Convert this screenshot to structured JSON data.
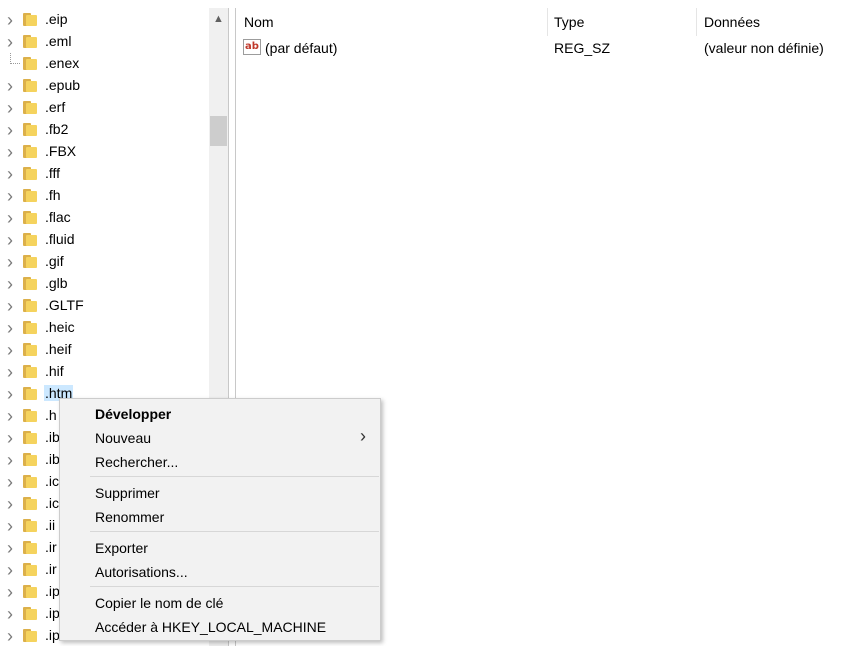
{
  "tree": {
    "items": [
      {
        "label": ".eip",
        "has_children": true
      },
      {
        "label": ".eml",
        "has_children": true
      },
      {
        "label": ".enex",
        "has_children": false
      },
      {
        "label": ".epub",
        "has_children": true
      },
      {
        "label": ".erf",
        "has_children": true
      },
      {
        "label": ".fb2",
        "has_children": true
      },
      {
        "label": ".FBX",
        "has_children": true
      },
      {
        "label": ".fff",
        "has_children": true
      },
      {
        "label": ".fh",
        "has_children": true
      },
      {
        "label": ".flac",
        "has_children": true
      },
      {
        "label": ".fluid",
        "has_children": true
      },
      {
        "label": ".gif",
        "has_children": true
      },
      {
        "label": ".glb",
        "has_children": true
      },
      {
        "label": ".GLTF",
        "has_children": true
      },
      {
        "label": ".heic",
        "has_children": true
      },
      {
        "label": ".heif",
        "has_children": true
      },
      {
        "label": ".hif",
        "has_children": true
      },
      {
        "label": ".htm",
        "has_children": true,
        "selected": true
      },
      {
        "label": ".h",
        "has_children": true
      },
      {
        "label": ".ib",
        "has_children": true
      },
      {
        "label": ".ib",
        "has_children": true
      },
      {
        "label": ".ic",
        "has_children": true
      },
      {
        "label": ".ic",
        "has_children": true
      },
      {
        "label": ".ii",
        "has_children": true
      },
      {
        "label": ".ir",
        "has_children": true
      },
      {
        "label": ".ir",
        "has_children": true
      },
      {
        "label": ".ip",
        "has_children": true
      },
      {
        "label": ".ip",
        "has_children": true
      },
      {
        "label": ".ip",
        "has_children": true
      }
    ]
  },
  "list": {
    "columns": {
      "name": "Nom",
      "type": "Type",
      "data": "Données"
    },
    "rows": [
      {
        "icon": "string-value-icon",
        "icon_text": "ab",
        "name": "(par défaut)",
        "type": "REG_SZ",
        "data": "(valeur non définie)"
      }
    ]
  },
  "context_menu": {
    "items": [
      {
        "label": "Développer",
        "bold": true
      },
      {
        "label": "Nouveau",
        "submenu": true
      },
      {
        "label": "Rechercher..."
      },
      {
        "separator": true
      },
      {
        "label": "Supprimer"
      },
      {
        "label": "Renommer"
      },
      {
        "separator": true
      },
      {
        "label": "Exporter"
      },
      {
        "label": "Autorisations..."
      },
      {
        "separator": true
      },
      {
        "label": "Copier le nom de clé"
      },
      {
        "label": "Accéder à HKEY_LOCAL_MACHINE"
      }
    ]
  },
  "colors": {
    "selection": "#cce8ff",
    "folder": "#f5d35e",
    "menu_bg": "#f2f2f2"
  }
}
